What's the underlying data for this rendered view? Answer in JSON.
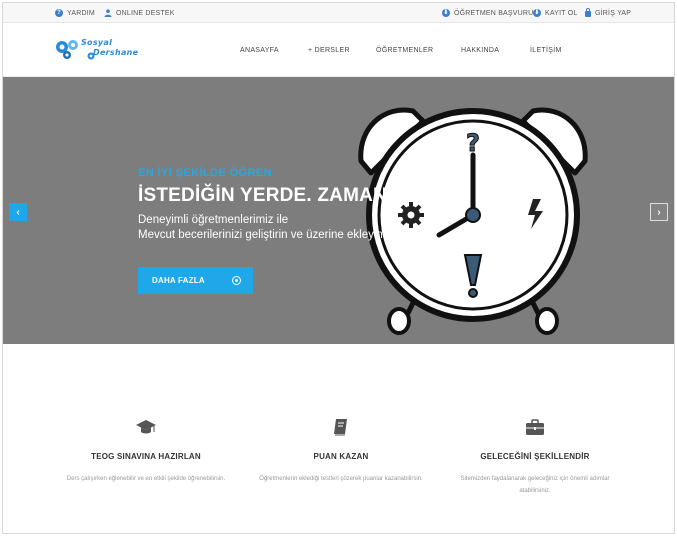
{
  "topbar": {
    "help": "YARDIM",
    "support": "ONLINE DESTEK",
    "teacher_apply": "ÖĞRETMEN BAŞVURU",
    "register": "KAYIT OL",
    "login": "GİRİŞ YAP"
  },
  "logo": {
    "line1": "Sosyal",
    "line2": "Dershane"
  },
  "nav": {
    "items": [
      "ANASAYFA",
      "+ DERSLER",
      "ÖĞRETMENLER",
      "HAKKINDA",
      "İLETİŞİM"
    ]
  },
  "hero": {
    "subtitle": "EN İYİ ŞEKİLDE ÖĞREN",
    "title": "İSTEDİĞİN YERDE. ZAMANDA.",
    "desc_line1": "Deneyimli öğretmenlerimiz ile",
    "desc_line2": "Mevcut becerilerinizi geliştirin ve üzerine ekleyin.",
    "button": "DAHA FAZLA",
    "prev": "‹",
    "next": "›"
  },
  "features": [
    {
      "icon": "graduation-cap-icon",
      "title": "TEOG SINAVINA HAZIRLAN",
      "desc": "Ders çalışırken eğlenebilir ve en etkili şekilde öğrenebilirsin."
    },
    {
      "icon": "book-icon",
      "title": "PUAN KAZAN",
      "desc": "Öğretmenlerin eklediği testleri çözerek puanlar kazanabilirsin."
    },
    {
      "icon": "briefcase-icon",
      "title": "GELECEĞİNİ ŞEKİLLENDİR",
      "desc": "Sitemizden faydalanarak geleceğiniz için önemli adımlar atabilirsiniz."
    }
  ],
  "colors": {
    "accent": "#1ea8ea",
    "hero_bg": "#7d7d7d",
    "subtitle": "#29a8e0"
  }
}
